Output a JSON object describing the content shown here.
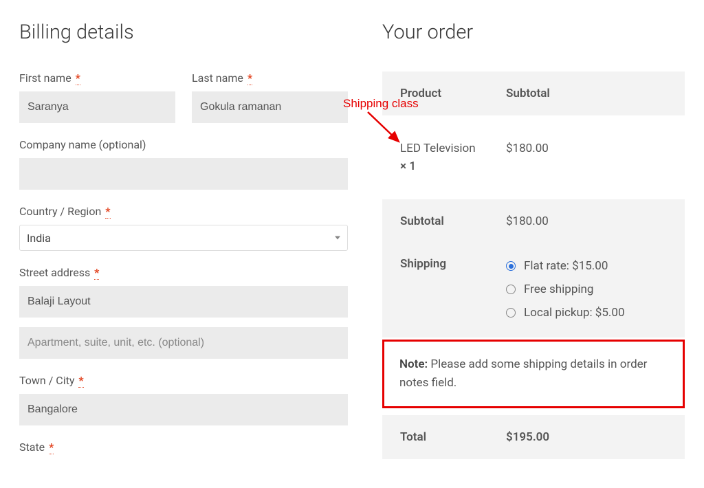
{
  "billing": {
    "heading": "Billing details",
    "first_name_label": "First name",
    "first_name": "Saranya",
    "last_name_label": "Last name",
    "last_name": "Gokula ramanan",
    "company_label": "Company name (optional)",
    "company": "",
    "country_label": "Country / Region",
    "country": "India",
    "street_label": "Street address",
    "street1": "Balaji Layout",
    "street2_placeholder": "Apartment, suite, unit, etc. (optional)",
    "city_label": "Town / City",
    "city": "Bangalore",
    "state_label": "State",
    "required_mark": "*"
  },
  "order": {
    "heading": "Your order",
    "head_product": "Product",
    "head_subtotal": "Subtotal",
    "item_name": "LED Television",
    "item_qty_prefix": "× ",
    "item_qty": "1",
    "item_price": "$180.00",
    "subtotal_label": "Subtotal",
    "subtotal": "$180.00",
    "shipping_label": "Shipping",
    "ship_flat": "Flat rate: $15.00",
    "ship_free": "Free shipping",
    "ship_local": "Local pickup: $5.00",
    "note_label": "Note:",
    "note_text": " Please add some shipping details in order notes field.",
    "total_label": "Total",
    "total": "$195.00"
  },
  "annotation": {
    "label": "Shipping class"
  }
}
